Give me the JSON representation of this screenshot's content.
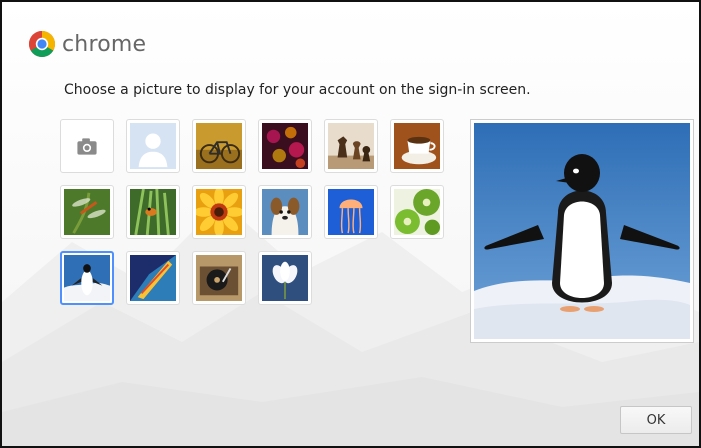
{
  "header": {
    "brand": "chrome",
    "logo_icon": "chrome-logo-icon"
  },
  "prompt": "Choose a picture to display for your account on the sign-in screen.",
  "pictures": [
    {
      "name": "take-photo",
      "icon": "camera-icon"
    },
    {
      "name": "profile-photo",
      "icon": "person-silhouette-icon"
    },
    {
      "name": "bicycle"
    },
    {
      "name": "bokeh-lights"
    },
    {
      "name": "chess-pieces"
    },
    {
      "name": "coffee-cup"
    },
    {
      "name": "dragonfly"
    },
    {
      "name": "frog-on-grass"
    },
    {
      "name": "sunflower"
    },
    {
      "name": "puppy"
    },
    {
      "name": "jellyfish"
    },
    {
      "name": "kiwi-fruit"
    },
    {
      "name": "penguin",
      "selected": true
    },
    {
      "name": "surfboard"
    },
    {
      "name": "record-player"
    },
    {
      "name": "white-flower"
    }
  ],
  "preview": {
    "name": "penguin"
  },
  "buttons": {
    "ok": "OK"
  },
  "colors": {
    "selection_border": "#4d90fe"
  }
}
